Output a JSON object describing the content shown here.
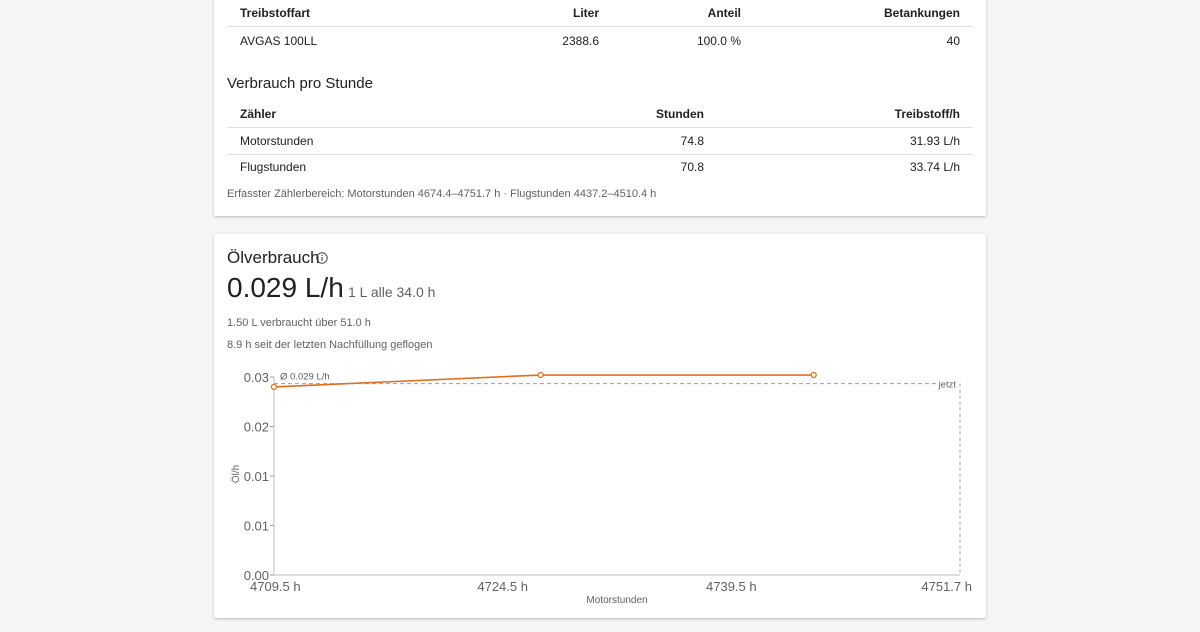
{
  "fuel_table": {
    "headers": [
      "Treibstoffart",
      "Liter",
      "Anteil",
      "Betankungen"
    ],
    "rows": [
      [
        "AVGAS 100LL",
        "2388.6",
        "100.0 %",
        "40"
      ]
    ]
  },
  "consumption": {
    "title": "Verbrauch pro Stunde",
    "headers": [
      "Zähler",
      "Stunden",
      "Treibstoff/h"
    ],
    "rows": [
      [
        "Motorstunden",
        "74.8",
        "31.93 L/h"
      ],
      [
        "Flugstunden",
        "70.8",
        "33.74 L/h"
      ]
    ],
    "range_note": "Erfasster Zählerbereich: Motorstunden 4674.4–4751.7 h · Flugstunden 4437.2–4510.4 h"
  },
  "oil": {
    "title": "Ölverbrauch",
    "info_icon": "info-icon",
    "rate": "0.029 L/h",
    "interval": "1 L alle 34.0 h",
    "used_note": "1.50 L verbraucht über 51.0 h",
    "since_refill_note": "8.9 h seit der letzten Nachfüllung geflogen"
  },
  "chart_data": {
    "type": "line",
    "xlabel": "Motorstunden",
    "ylabel": "Öl/h",
    "x_ticks": [
      "4709.5 h",
      "4724.5 h",
      "4739.5 h",
      "4751.7 h"
    ],
    "y_ticks": [
      "0.00",
      "0.01",
      "0.01",
      "0.02",
      "0.03"
    ],
    "xlim": [
      4709.5,
      4751.7
    ],
    "ylim": [
      0,
      0.03
    ],
    "grid": false,
    "series": [
      {
        "x": [
          4709.5,
          4725.9,
          4742.7
        ],
        "y": [
          0.0285,
          0.0303,
          0.0303
        ],
        "color": "#e07020"
      }
    ],
    "average": {
      "value": 0.029,
      "label": "Ø 0.029 L/h"
    },
    "now_marker": {
      "x": 4751.7,
      "label": "jetzt"
    }
  }
}
